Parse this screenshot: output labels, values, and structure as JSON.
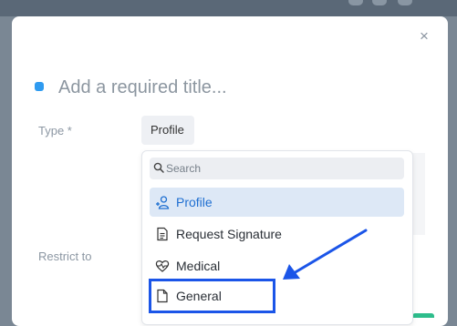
{
  "modal": {
    "close_glyph": "×",
    "title_placeholder": "Add a required title...",
    "type_label": "Type *",
    "type_value": "Profile",
    "restrict_label": "Restrict to"
  },
  "dropdown": {
    "search_placeholder": "Search",
    "options": [
      {
        "label": "Profile",
        "icon": "add-user-icon",
        "selected": true
      },
      {
        "label": "Request Signature",
        "icon": "document-icon",
        "selected": false
      },
      {
        "label": "Medical",
        "icon": "heart-pulse-icon",
        "selected": false
      },
      {
        "label": "General",
        "icon": "file-icon",
        "selected": false
      }
    ]
  },
  "colors": {
    "accent": "#2f9bf0",
    "selected_bg": "#dde8f6",
    "selected_text": "#1f6fd1",
    "annotation": "#1b55e8"
  }
}
